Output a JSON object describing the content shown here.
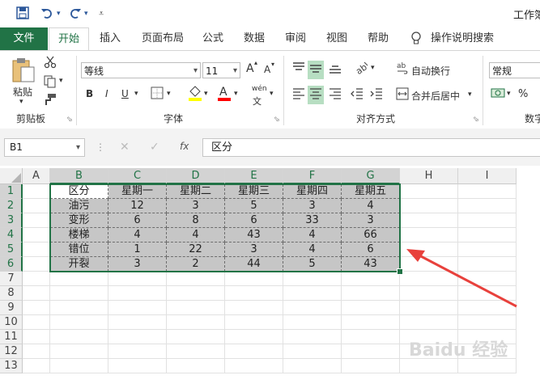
{
  "window": {
    "title": "工作簿"
  },
  "qat": {
    "save_icon": "save-icon",
    "undo_icon": "undo-icon",
    "redo_icon": "redo-icon",
    "customize_icon": "customize-qat-icon"
  },
  "tabs": [
    "文件",
    "开始",
    "插入",
    "页面布局",
    "公式",
    "数据",
    "审阅",
    "视图",
    "帮助",
    "操作说明搜索"
  ],
  "ribbon": {
    "clipboard": {
      "paste_label": "粘贴",
      "group_label": "剪贴板"
    },
    "font": {
      "font_name": "等线",
      "font_size": "11",
      "bold": "B",
      "italic": "I",
      "underline": "U",
      "group_label": "字体",
      "grow": "A",
      "shrink": "A",
      "pinyin": "wén"
    },
    "alignment": {
      "wrap_text": "自动换行",
      "merge_center": "合并后居中",
      "group_label": "对齐方式"
    },
    "number": {
      "format": "常规",
      "percent": "%",
      "group_label": "数字"
    }
  },
  "formula_bar": {
    "name_box": "B1",
    "content": "区分",
    "fx": "fx"
  },
  "columns": [
    "A",
    "B",
    "C",
    "D",
    "E",
    "F",
    "G",
    "H",
    "I"
  ],
  "rows": [
    "1",
    "2",
    "3",
    "4",
    "5",
    "6",
    "7",
    "8",
    "9",
    "10",
    "11",
    "12",
    "13"
  ],
  "table": {
    "headers": [
      "区分",
      "星期一",
      "星期二",
      "星期三",
      "星期四",
      "星期五"
    ],
    "rows": [
      [
        "油污",
        "12",
        "3",
        "5",
        "3",
        "4"
      ],
      [
        "变形",
        "6",
        "8",
        "6",
        "33",
        "3"
      ],
      [
        "楼梯",
        "4",
        "4",
        "43",
        "4",
        "66"
      ],
      [
        "错位",
        "1",
        "22",
        "3",
        "4",
        "6"
      ],
      [
        "开裂",
        "3",
        "2",
        "44",
        "5",
        "43"
      ]
    ]
  },
  "colors": {
    "excel_green": "#217346",
    "arrow_red": "#e8413c"
  }
}
